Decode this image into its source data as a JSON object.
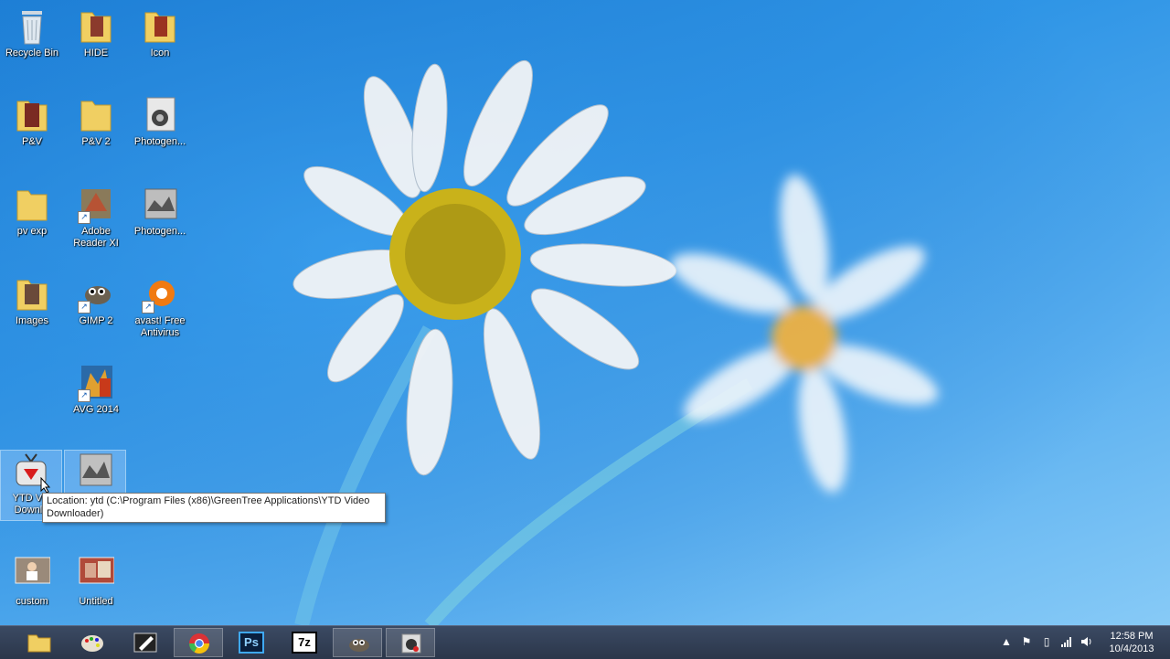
{
  "desktop": {
    "icons": [
      {
        "label": "Recycle Bin",
        "icon": "recycle-bin-icon"
      },
      {
        "label": "HIDE",
        "icon": "folder-icon"
      },
      {
        "label": "Icon",
        "icon": "folder-icon"
      },
      {
        "label": "P&V",
        "icon": "folder-icon"
      },
      {
        "label": "P&V 2",
        "icon": "folder-icon"
      },
      {
        "label": "Photogen...",
        "icon": "photogenics-icon"
      },
      {
        "label": "pv exp",
        "icon": "folder-icon"
      },
      {
        "label": "Adobe Reader XI",
        "icon": "adobe-reader-icon"
      },
      {
        "label": "Photogen...",
        "icon": "photogenics-icon"
      },
      {
        "label": "Images",
        "icon": "folder-icon"
      },
      {
        "label": "GIMP 2",
        "icon": "gimp-icon"
      },
      {
        "label": "avast! Free Antivirus",
        "icon": "avast-icon"
      },
      {
        "label": "AVG 2014",
        "icon": "avg-icon"
      },
      {
        "label": "YTD Vid Downlo",
        "icon": "ytd-icon"
      },
      {
        "label": "",
        "icon": "photogenics-icon"
      },
      {
        "label": "custom",
        "icon": "image-file-icon"
      },
      {
        "label": "Untitled",
        "icon": "image-file-icon"
      }
    ]
  },
  "tooltip": {
    "text": "Location: ytd (C:\\Program Files (x86)\\GreenTree Applications\\YTD Video Downloader)"
  },
  "taskbar": {
    "pinned": [
      {
        "name": "file-explorer",
        "icon": "folder-icon"
      },
      {
        "name": "paint",
        "icon": "palette-icon"
      },
      {
        "name": "pen-app",
        "icon": "pen-icon"
      },
      {
        "name": "chrome",
        "icon": "chrome-icon"
      },
      {
        "name": "photoshop",
        "icon": "photoshop-icon",
        "text": "Ps"
      },
      {
        "name": "7zip",
        "icon": "7zip-icon",
        "text": "7z"
      },
      {
        "name": "gimp",
        "icon": "gimp-icon"
      },
      {
        "name": "photogenics",
        "icon": "photogenics-icon"
      }
    ],
    "clock": {
      "time": "12:58 PM",
      "date": "10/4/2013"
    }
  },
  "colors": {
    "taskbar": "#2f3a4f",
    "wallpaper": "#2f95e6",
    "tooltip_bg": "#ffffff"
  }
}
